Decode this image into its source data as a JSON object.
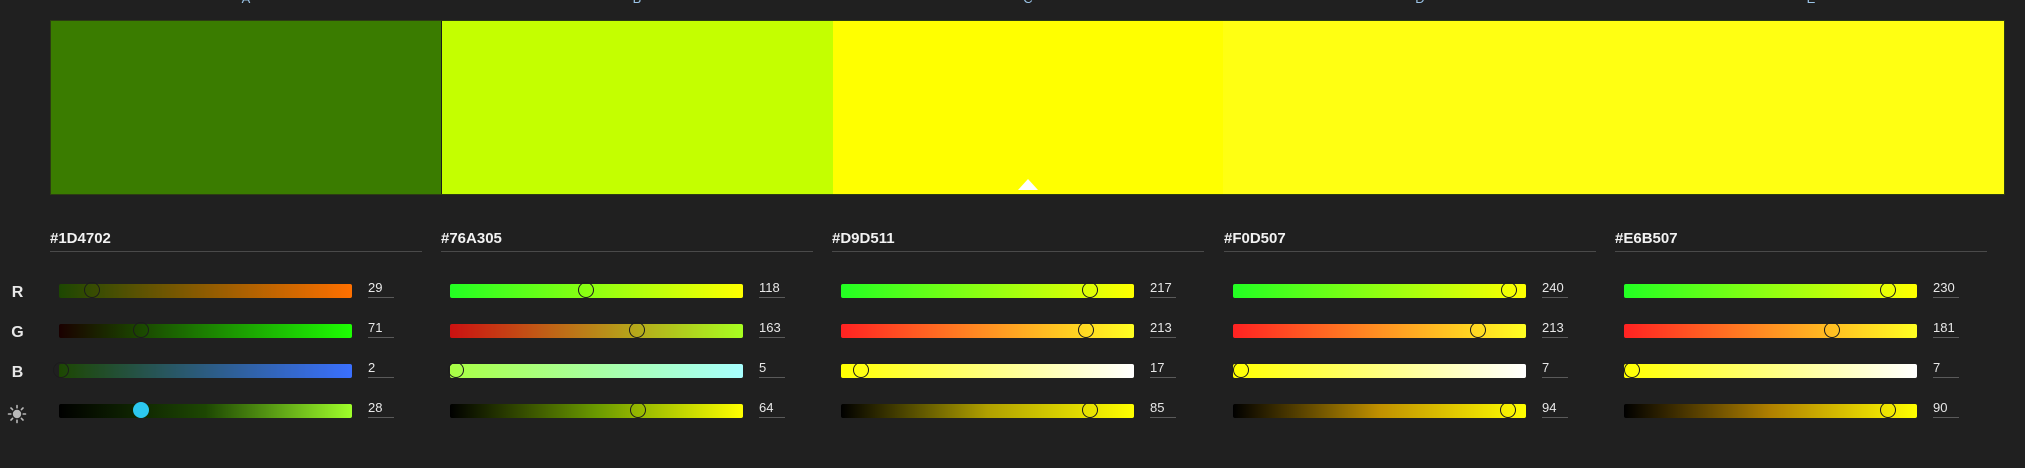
{
  "columns": [
    {
      "letter": "A",
      "hex": "#1D4702",
      "swatch_color": "#3A7C00",
      "r": 29,
      "g": 71,
      "b": 2,
      "l": 28,
      "grad": {
        "r": [
          "#1D4702",
          "#FF7000"
        ],
        "g": [
          "#1A0000",
          "#1DFF02"
        ],
        "b": [
          "#1D4702",
          "#3A70FF"
        ],
        "l": [
          "#000000",
          "#1D4702",
          "#9FFF2A"
        ]
      }
    },
    {
      "letter": "B",
      "hex": "#76A305",
      "swatch_color": "#C4FF00",
      "r": 118,
      "g": 163,
      "b": 5,
      "l": 64,
      "grad": {
        "r": [
          "#22FF22",
          "#FFFF00"
        ],
        "g": [
          "#CC1111",
          "#A8FF20"
        ],
        "b": [
          "#A9FF44",
          "#A8FFFF"
        ],
        "l": [
          "#000000",
          "#6A9A00",
          "#FFFF00"
        ]
      }
    },
    {
      "letter": "C",
      "hex": "#D9D511",
      "swatch_color": "#FFFF00",
      "r": 217,
      "g": 213,
      "b": 17,
      "l": 85,
      "grad": {
        "r": [
          "#22FF22",
          "#FFFF00"
        ],
        "g": [
          "#FF2222",
          "#FFFF22"
        ],
        "b": [
          "#FFFF00",
          "#FFFFFF"
        ],
        "l": [
          "#000000",
          "#B0A000",
          "#FFFF00"
        ]
      }
    },
    {
      "letter": "D",
      "hex": "#F0D507",
      "swatch_color": "#FFFF12",
      "r": 240,
      "g": 213,
      "b": 7,
      "l": 94,
      "grad": {
        "r": [
          "#22FF22",
          "#FFFF00"
        ],
        "g": [
          "#FF2222",
          "#FFFF22"
        ],
        "b": [
          "#FFFF00",
          "#FFFFFF"
        ],
        "l": [
          "#000000",
          "#C09000",
          "#FFFF00"
        ]
      }
    },
    {
      "letter": "E",
      "hex": "#E6B507",
      "swatch_color": "#FFFF12",
      "r": 230,
      "g": 181,
      "b": 7,
      "l": 90,
      "grad": {
        "r": [
          "#22FF22",
          "#FFFF00"
        ],
        "g": [
          "#FF2222",
          "#FFFF22"
        ],
        "b": [
          "#FFFF00",
          "#FFFFFF"
        ],
        "l": [
          "#000000",
          "#B08000",
          "#FFFF00"
        ]
      }
    }
  ],
  "rows": {
    "r": "R",
    "g": "G",
    "b": "B",
    "l_icon": "brightness-icon"
  },
  "selected_column": 2,
  "active_slider": {
    "column": 0,
    "row": "l"
  }
}
